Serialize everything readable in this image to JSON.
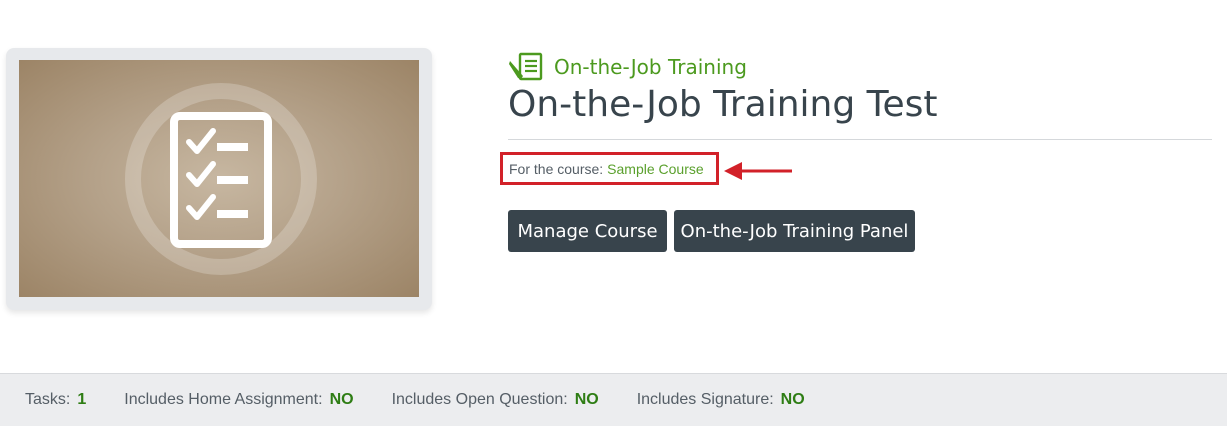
{
  "thumbnail": {
    "icon": "checklist-icon",
    "background_color": "#b4a189"
  },
  "header": {
    "category_icon": "document-pencil-icon",
    "category_label": "On-the-Job Training",
    "title": "On-the-Job Training Test"
  },
  "course": {
    "prefix": "For the course:",
    "link_text": "Sample Course"
  },
  "annotation": {
    "icon": "red-arrow-icon",
    "color": "#d22129"
  },
  "buttons": {
    "manage_label": "Manage Course",
    "panel_label": "On-the-Job Training Panel"
  },
  "info": {
    "tasks_label": "Tasks:",
    "tasks_value": "1",
    "home_label": "Includes Home Assignment:",
    "home_value": "NO",
    "question_label": "Includes Open Question:",
    "question_value": "NO",
    "signature_label": "Includes Signature:",
    "signature_value": "NO"
  },
  "colors": {
    "accent_green": "#4c9a1f",
    "button_dark": "#38444c",
    "highlight_red": "#d22129"
  }
}
